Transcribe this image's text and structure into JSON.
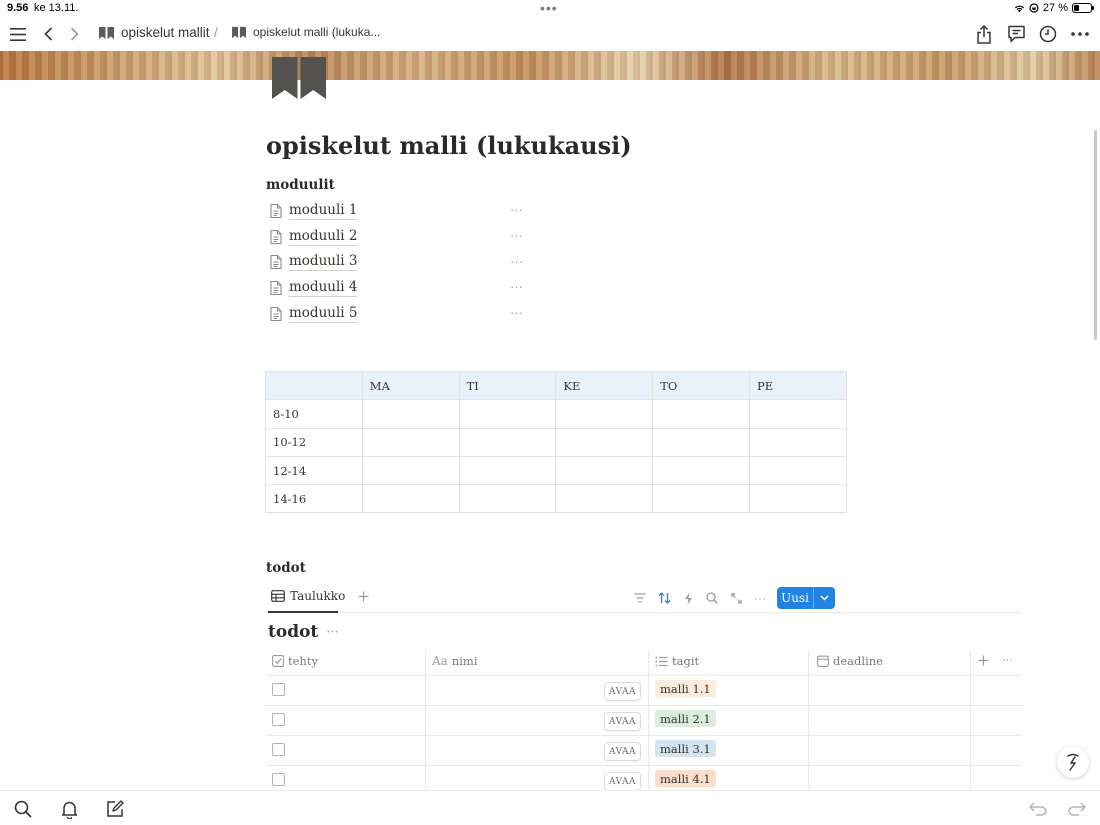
{
  "status_bar": {
    "time": "9.56",
    "date": "ke 13.11.",
    "battery": "27 %"
  },
  "header": {
    "breadcrumbs": [
      {
        "label": "opiskelut mallit"
      },
      {
        "label": "opiskelut malli (lukuka..."
      }
    ],
    "separator": "/"
  },
  "page": {
    "title": "opiskelut malli (lukukausi)"
  },
  "modules": {
    "heading": "moduulit",
    "more": "···",
    "items": [
      "moduuli 1",
      "moduuli 2",
      "moduuli 3",
      "moduuli 4",
      "moduuli 5"
    ]
  },
  "schedule": {
    "columns": [
      "",
      "MA",
      "TI",
      "KE",
      "TO",
      "PE"
    ],
    "rows": [
      "8-10",
      "10-12",
      "12-14",
      "14-16"
    ]
  },
  "todos": {
    "heading": "todot",
    "view_tab": "Taulukko",
    "new_button": "Uusi",
    "db_title": "todot",
    "more": "···",
    "columns": {
      "done": "tehty",
      "name_prefix": "Aa",
      "name": "nimi",
      "tags": "tagit",
      "deadline": "deadline"
    },
    "open_label": "AVAA",
    "rows": [
      {
        "tag": "malli 1.1",
        "tag_color": "#fbecdd"
      },
      {
        "tag": "malli 2.1",
        "tag_color": "#dbeddb"
      },
      {
        "tag": "malli 3.1",
        "tag_color": "#d3e5ef"
      },
      {
        "tag": "malli 4.1",
        "tag_color": "#fadec9"
      }
    ]
  },
  "colors": {
    "accent": "#2383e2",
    "table_header": "#e8f1f9",
    "text": "#37352f"
  }
}
